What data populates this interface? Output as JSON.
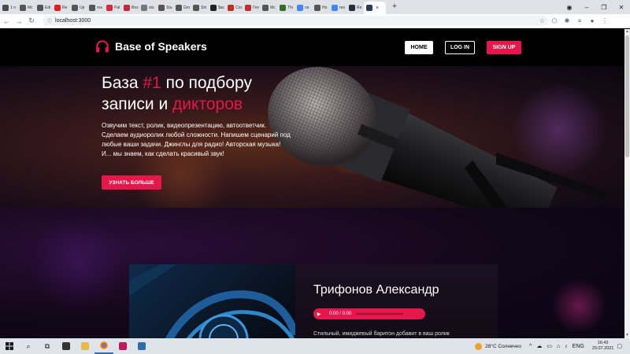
{
  "browser": {
    "tabs": [
      {
        "label": "1 n",
        "color": "#4a4a4a"
      },
      {
        "label": "Mc",
        "color": "#555555"
      },
      {
        "label": "Edi",
        "color": "#555555"
      },
      {
        "label": "Re",
        "color": "#e02020"
      },
      {
        "label": "Up",
        "color": "#555555"
      },
      {
        "label": "ma",
        "color": "#555555"
      },
      {
        "label": "Pal",
        "color": "#d42a3a"
      },
      {
        "label": "Bes",
        "color": "#c02a3a"
      },
      {
        "label": "stu",
        "color": "#777777"
      },
      {
        "label": "Stu",
        "color": "#555555"
      },
      {
        "label": "Gm",
        "color": "#555555"
      },
      {
        "label": "Shi",
        "color": "#555555"
      },
      {
        "label": "$ac",
        "color": "#222222"
      },
      {
        "label": "Coc",
        "color": "#c03020"
      },
      {
        "label": "Гео",
        "color": "#c03030"
      },
      {
        "label": "Mc",
        "color": "#555555"
      },
      {
        "label": "Thi",
        "color": "#3a6a2a"
      },
      {
        "label": "no",
        "color": "#4285f4"
      },
      {
        "label": "Ho",
        "color": "#555555"
      },
      {
        "label": "res",
        "color": "#4285f4"
      },
      {
        "label": "Re",
        "color": "#2a2a3a"
      },
      {
        "label": "",
        "color": "#2a3a5a",
        "active": true
      }
    ],
    "url": "localhost:3000"
  },
  "site": {
    "logo_text": "Base of Speakers",
    "nav": {
      "home": "HOME",
      "login": "LOG IN",
      "signup": "SIGN UP"
    },
    "hero": {
      "title_part1": "База ",
      "title_accent1": "#1",
      "title_part2": " по подбору",
      "title_part3": "записи и ",
      "title_accent2": "дикторов",
      "description": "Озвучим текст, ролик, видеопрезентацию, автоответчик. Сделаем аудиоролик любой сложности. Напишем сценарий под любые ваши задачи. Джинглы для радио! Авторская музыка! И... мы знаем, как сделать красивый звук!",
      "cta": "УЗНАТЬ БОЛЬШЕ"
    },
    "speaker_card": {
      "name": "Трифонов Александр",
      "time": "0:00 / 0:00",
      "description": "Стильный, имиджевый баритон добавит в ваш ролик"
    }
  },
  "taskbar": {
    "weather": "28°C  Солнечно",
    "lang": "ENG",
    "time": "16:43",
    "date": "29.07.2021"
  },
  "colors": {
    "accent": "#e6174b"
  }
}
